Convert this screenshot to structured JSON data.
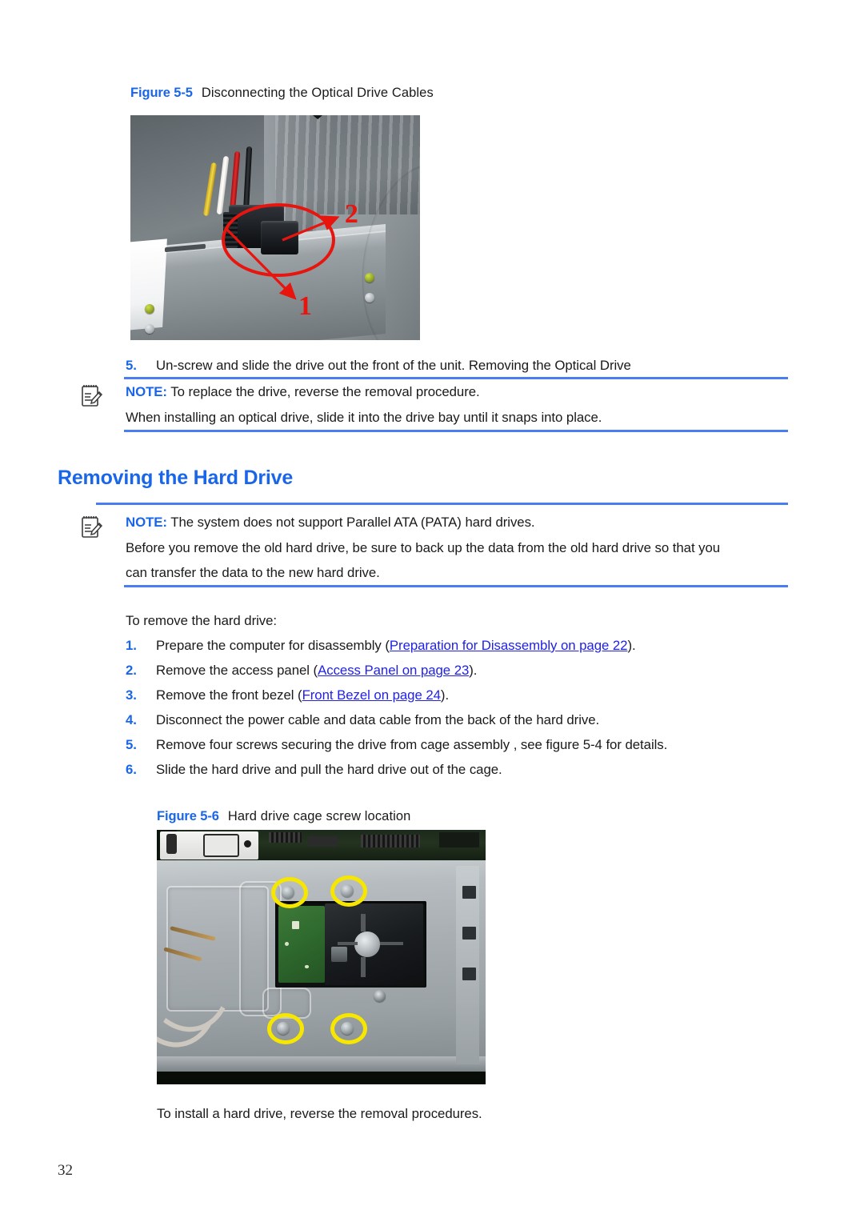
{
  "document": {
    "page_number": "32"
  },
  "figures": [
    {
      "id": "figure-5-5",
      "label": "Figure 5-5",
      "caption": "Disconnecting the Optical Drive Cables",
      "image_alt": "Photo of optical drive rear showing SATA power and data cables",
      "annotations": [
        {
          "name": "callout-1",
          "text": "1",
          "color": "#e8150f"
        },
        {
          "name": "callout-2",
          "text": "2",
          "color": "#e8150f"
        }
      ]
    },
    {
      "id": "figure-5-6",
      "label": "Figure 5-6",
      "caption": "Hard drive cage screw location",
      "image_alt": "Photo of hard drive cage with four screw locations circled in yellow",
      "annotations": [
        {
          "name": "screw-highlight-1",
          "color": "#f7e600"
        },
        {
          "name": "screw-highlight-2",
          "color": "#f7e600"
        },
        {
          "name": "screw-highlight-3",
          "color": "#f7e600"
        },
        {
          "name": "screw-highlight-4",
          "color": "#f7e600"
        }
      ]
    }
  ],
  "optical_section": {
    "step5": {
      "number": "5.",
      "text": "Un-screw and slide the drive out the front of the unit. Removing the Optical Drive"
    },
    "note": {
      "label": "NOTE:",
      "text": "To replace the drive, reverse the removal procedure.",
      "icon": "note-pencil-icon"
    },
    "note_followup": "When installing an optical drive, slide it into the drive bay until it snaps into place."
  },
  "hard_drive_section": {
    "heading": "Removing the Hard Drive",
    "note": {
      "label": "NOTE:",
      "text": "The system does not support Parallel ATA (PATA) hard drives.",
      "icon": "note-pencil-icon"
    },
    "note_para_1": "Before you remove the old hard drive, be sure to back up the data from the old hard drive so that you",
    "note_para_2": "can transfer the data to the new hard drive.",
    "intro": "To remove the hard drive:",
    "steps": [
      {
        "number": "1.",
        "before": "Prepare the computer for disassembly (",
        "link": "Preparation for Disassembly on page 22",
        "after": ")."
      },
      {
        "number": "2.",
        "before": "Remove the access panel (",
        "link": "Access Panel on page 23",
        "after": ")."
      },
      {
        "number": "3.",
        "before": "Remove the front bezel (",
        "link": "Front Bezel on page 24",
        "after": ")."
      },
      {
        "number": "4.",
        "before": "Disconnect the power cable and data cable from the back of the hard drive.",
        "link": "",
        "after": ""
      },
      {
        "number": "5.",
        "before": "Remove four screws securing the drive from cage assembly , see figure 5-4 for details.",
        "link": "",
        "after": ""
      },
      {
        "number": "6.",
        "before": "Slide the hard drive and pull the hard drive out of the cage.",
        "link": "",
        "after": ""
      }
    ],
    "closing": "To install a hard drive, reverse the removal procedures."
  },
  "colors": {
    "accent_blue": "#1a66e8",
    "rule_blue": "#4a7df0",
    "link_blue": "#2121e8",
    "annotation_red": "#e8150f",
    "annotation_yellow": "#f7e600",
    "body_text": "#1a1a1a"
  }
}
